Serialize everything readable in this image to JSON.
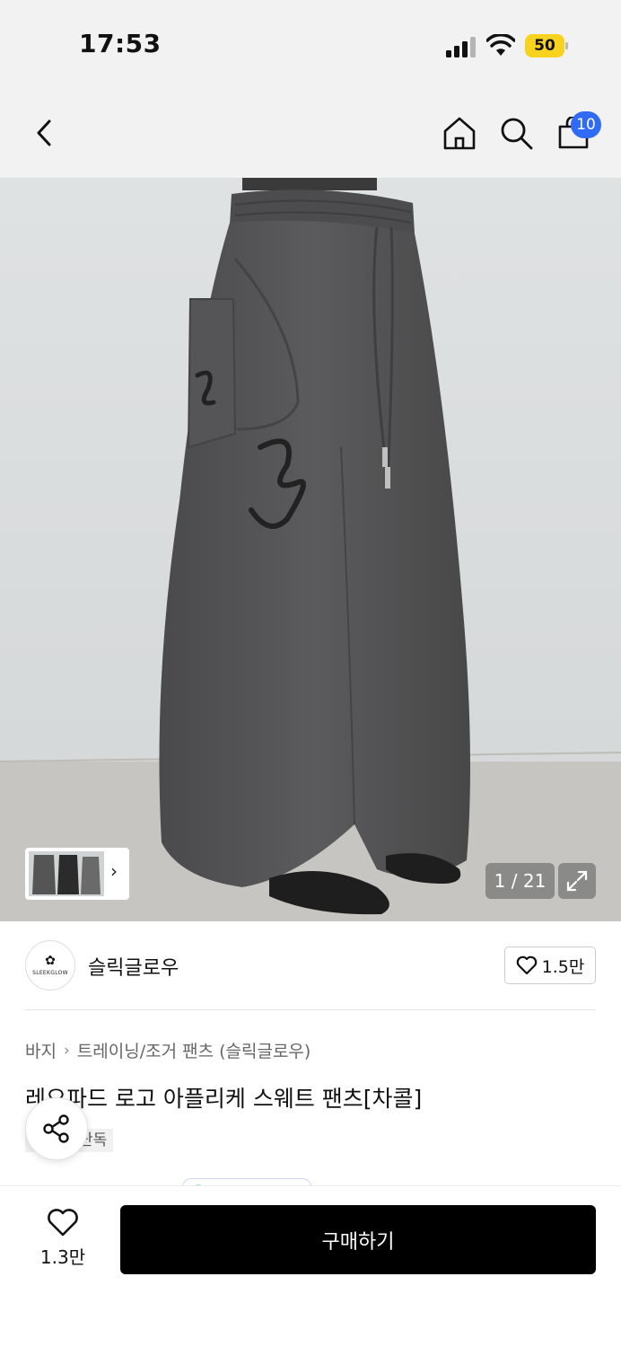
{
  "status_bar": {
    "time": "17:53",
    "battery": "50"
  },
  "nav": {
    "cart_count": "10"
  },
  "gallery": {
    "counter": "1 / 21"
  },
  "brand": {
    "name": "슬릭글로우",
    "logo_text": "SLEEKGLOW",
    "likes": "1.5만"
  },
  "breadcrumb": {
    "category": "바지",
    "subcategory": "트레이닝/조거 팬츠 (슬릭글로우)"
  },
  "product": {
    "title": "레오파드 로고 아플리케 스웨트 팬츠[차콜]",
    "tag": "단독"
  },
  "bottom": {
    "wish_count": "1.3만",
    "buy_label": "구매하기"
  },
  "icons": [
    "chevron-left-icon",
    "home-icon",
    "search-icon",
    "shopping-bag-icon",
    "heart-icon",
    "share-icon",
    "expand-icon",
    "chevron-right-icon"
  ],
  "colors": {
    "badge": "#2f6bf5",
    "battery": "#f7d21e",
    "buy_button": "#000000"
  }
}
